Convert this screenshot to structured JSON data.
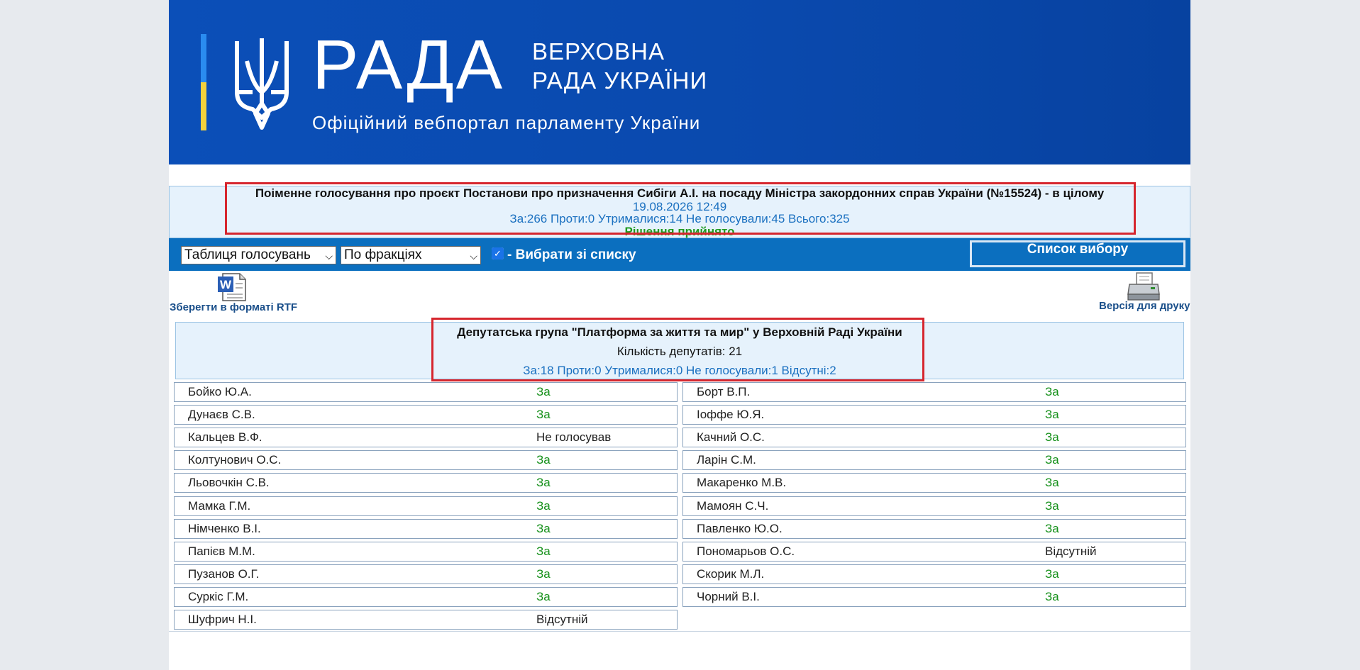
{
  "header": {
    "logo_main": "РАДА",
    "logo_sub1": "ВЕРХОВНА",
    "logo_sub2": "РАДА УКРАЇНИ",
    "tagline": "Офіційний вебпортал парламенту України",
    "colors": {
      "background": "#0b4fb8",
      "flag_blue": "#2a8cf0",
      "flag_yellow": "#f4d23c"
    }
  },
  "vote": {
    "title": "Поіменне голосування про проєкт Постанови про призначення Сибіги А.І. на посаду Міністра закордонних справ України (№15524) - в цілому",
    "datetime": "19.08.2026 12:49",
    "stats": "За:266 Проти:0 Утрималися:14 Не голосували:45 Всього:325",
    "result": "Рішення прийнято"
  },
  "toolbar": {
    "view_select": "Таблиця голосувань",
    "group_select": "По фракціях",
    "checkbox_checked": true,
    "checkbox_label": "- Вибрати зі списку",
    "list_button": "Список вибору"
  },
  "actions": {
    "rtf_label": "Зберегти в форматі RTF",
    "word_icon": "word-document-icon",
    "print_label": "Версія для друку",
    "print_icon": "printer-icon"
  },
  "faction": {
    "title": "Депутатська група \"Платформа за життя та мир\" у Верховній Раді України",
    "count": "Кількість депутатів: 21",
    "stats": "За:18 Проти:0 Утрималися:0 Не голосували:1 Відсутні:2"
  },
  "deputies_left": [
    {
      "name": "Бойко Ю.А.",
      "vote": "За"
    },
    {
      "name": "Дунаєв С.В.",
      "vote": "За"
    },
    {
      "name": "Кальцев В.Ф.",
      "vote": "Не голосував"
    },
    {
      "name": "Колтунович О.С.",
      "vote": "За"
    },
    {
      "name": "Льовочкін С.В.",
      "vote": "За"
    },
    {
      "name": "Мамка Г.М.",
      "vote": "За"
    },
    {
      "name": "Німченко В.І.",
      "vote": "За"
    },
    {
      "name": "Папієв М.М.",
      "vote": "За"
    },
    {
      "name": "Пузанов О.Г.",
      "vote": "За"
    },
    {
      "name": "Суркіс Г.М.",
      "vote": "За"
    },
    {
      "name": "Шуфрич Н.І.",
      "vote": "Відсутній"
    }
  ],
  "deputies_right": [
    {
      "name": "Борт В.П.",
      "vote": "За"
    },
    {
      "name": "Іоффе Ю.Я.",
      "vote": "За"
    },
    {
      "name": "Качний О.С.",
      "vote": "За"
    },
    {
      "name": "Ларін С.М.",
      "vote": "За"
    },
    {
      "name": "Макаренко М.В.",
      "vote": "За"
    },
    {
      "name": "Мамоян С.Ч.",
      "vote": "За"
    },
    {
      "name": "Павленко Ю.О.",
      "vote": "За"
    },
    {
      "name": "Пономарьов О.С.",
      "vote": "Відсутній"
    },
    {
      "name": "Скорик М.Л.",
      "vote": "За"
    },
    {
      "name": "Чорний В.І.",
      "vote": "За"
    }
  ],
  "colors": {
    "vote_for": "#17911c",
    "highlight": "#d6262e",
    "toolbar": "#0b6fbf"
  }
}
